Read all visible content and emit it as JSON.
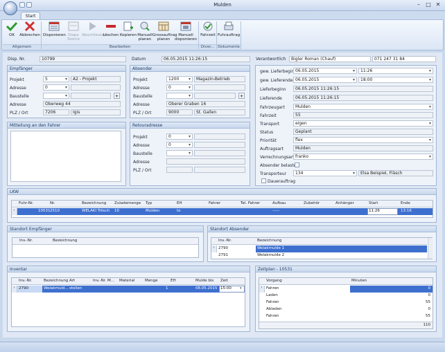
{
  "window": {
    "title": "Mulden",
    "tab": "Start",
    "min": "–",
    "max": "□",
    "close": "✕"
  },
  "ribbon": {
    "buttons": [
      {
        "label": "OK",
        "icon": "check-icon",
        "color": "#2d9a2d"
      },
      {
        "label": "Abbrechen",
        "icon": "cancel-x-icon",
        "color": "#d23030"
      },
      {
        "label": "Disponieren",
        "icon": "disposition-icon"
      },
      {
        "label": "Dispo Storno",
        "icon": "dispo-storno-icon"
      },
      {
        "label": "Abschliessen",
        "icon": "play-icon"
      },
      {
        "label": "Löschen",
        "icon": "delete-icon",
        "color": "#c62828"
      },
      {
        "label": "Kopieren",
        "icon": "copy-icon"
      },
      {
        "label": "Manuell planen",
        "icon": "manual-plan-icon"
      },
      {
        "label": "Grossauftrag planen",
        "icon": "calendar-icon"
      },
      {
        "label": "Manuell disponieren",
        "icon": "manual-dispo-icon"
      },
      {
        "label": "Fahrzeit",
        "icon": "fahrzeit-icon"
      },
      {
        "label": "Fuhrauftrag",
        "icon": "fuhrauftrag-icon"
      }
    ],
    "groups": [
      "Allgemein",
      "Bearbeiten",
      "Diver...",
      "Dokumente"
    ]
  },
  "header": {
    "disp_label": "Disp. Nr.",
    "disp_value": "10799",
    "datum_label": "Datum",
    "datum_value": "06.05.2015 11:26:15",
    "verantwortlich_label": "Verantwortlich",
    "verantwortlich_value": "Bigler Roman (Chauf)",
    "phone": "071 247 31 84"
  },
  "empfaenger": {
    "title": "Empfänger",
    "projekt_label": "Projekt",
    "projekt_value": "5",
    "projekt_name": "A2 - Projekt",
    "adresse_label": "Adresse",
    "adresse_value": "0",
    "baustelle_label": "Baustelle",
    "adresse2_label": "Adresse",
    "adresse2_value": "Oberweg 44",
    "plz_label": "PLZ / Ort",
    "plz_value": "7206",
    "ort_value": "Igis"
  },
  "absender": {
    "title": "Absender",
    "projekt_label": "Projekt",
    "projekt_value": "1200",
    "projekt_name": "Magazin-Betrieb",
    "adresse_label": "Adresse",
    "adresse_value": "0",
    "baustelle_label": "Baustelle",
    "adresse2_label": "Adresse",
    "adresse2_value": "Oberer Graben 16",
    "plz_label": "PLZ / Ort",
    "plz_value": "9000",
    "ort_value": "St. Gallen"
  },
  "mitteilung": {
    "title": "Mitteilung an den Fahrer"
  },
  "retour": {
    "title": "Retouradresse",
    "projekt_label": "Projekt",
    "projekt_value": "0",
    "adresse_label": "Adresse",
    "adresse_value": "0",
    "baustelle_label": "Baustelle",
    "adresse2_label": "Adresse",
    "plz_label": "PLZ / Ort"
  },
  "details": {
    "lieferbeginn_label": "gew. Lieferbeginn",
    "lieferbeginn_date": "06.05.2015",
    "lieferbeginn_time": "11:26",
    "lieferende_label": "gew. Lieferende",
    "lieferende_date": "06.05.2015",
    "lieferende_time": "18:00",
    "lb_label": "Lieferbeginn",
    "lb_value": "06.05.2015 11:26:15",
    "le_label": "Lieferende",
    "le_value": "06.05.2015 11:26:15",
    "fahrzeugart_label": "Fahrzeugart",
    "fahrzeugart_value": "Mulden",
    "fahrzeit_label": "Fahrzeit",
    "fahrzeit_value": "55",
    "transport_label": "Transport",
    "transport_value": "eigen",
    "status_label": "Status",
    "status_value": "Geplant",
    "prioritaet_label": "Priorität",
    "prioritaet_value": "flex",
    "auftragsart_label": "Auftragsart",
    "auftragsart_value": "Mulden",
    "verrechnung_label": "Verrechnungsart",
    "verrechnung_value": "franko",
    "absender_belasten_label": "Absender belasten",
    "transporteur_label": "Transporteur",
    "transporteur_value": "134",
    "transporteur_name": "Elsa Beispiel, Fläsch",
    "dauerauftrag_label": "Dauerauftrag"
  },
  "lkw": {
    "title": "LKW",
    "columns": [
      "Fuhr-Nr.",
      "Nr.",
      "Bezeichnung",
      "Zulademenge",
      "Typ",
      "EH",
      "Fahrer",
      "Tel. Fahrer",
      "Aufbau",
      "Zubehör",
      "Anhänger",
      "Start",
      "Ende"
    ],
    "row": [
      "10531",
      "2510",
      "WELAKI Trösch",
      "10",
      "Mulden",
      "to",
      "",
      "",
      "-----",
      "",
      "",
      "11:26",
      "13:16"
    ]
  },
  "standort_empfaenger": {
    "title": "Standort Empfänger",
    "columns": [
      "Inv.-Nr.",
      "Bezeichnung"
    ]
  },
  "standort_absender": {
    "title": "Standort Absender",
    "columns": [
      "Inv.-Nr.",
      "Bezeichnung"
    ],
    "rows": [
      [
        "2790",
        "Welakmulde 1"
      ],
      [
        "2791",
        "Welakmulde 2"
      ]
    ]
  },
  "inventar": {
    "title": "Inventar",
    "columns": [
      "Inv.-Nr.",
      "Bezeichnung",
      "Art",
      "Inv.-Nr. M...",
      "Material",
      "Menge",
      "EH",
      "Mulde bis",
      "Zeit"
    ],
    "row": [
      "2790",
      "Welakmuld...",
      "stellen",
      "",
      "",
      "1",
      "",
      "08.05.2015",
      "15:00"
    ]
  },
  "zeitplan": {
    "title": "Zeitplan - 10531",
    "columns": [
      "Vorgang",
      "Minuten"
    ],
    "rows": [
      [
        "Fahren",
        "0"
      ],
      [
        "Laden",
        "0"
      ],
      [
        "Fahren",
        "55"
      ],
      [
        "Abladen",
        "0"
      ],
      [
        "Fahren",
        "55"
      ]
    ],
    "total": "110"
  }
}
